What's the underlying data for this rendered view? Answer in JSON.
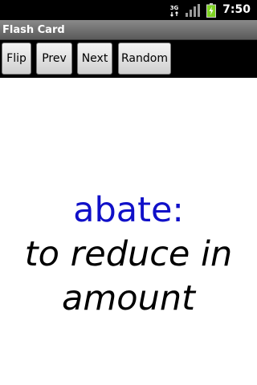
{
  "status_bar": {
    "time": "7:50",
    "network_label": "3G"
  },
  "title_bar": {
    "title": "Flash Card"
  },
  "toolbar": {
    "flip_label": "Flip",
    "prev_label": "Prev",
    "next_label": "Next",
    "random_label": "Random"
  },
  "card": {
    "term": "abate:",
    "definition": "to reduce in amount"
  },
  "colors": {
    "term": "#1010c8",
    "definition": "#000000",
    "battery": "#7ed321"
  }
}
